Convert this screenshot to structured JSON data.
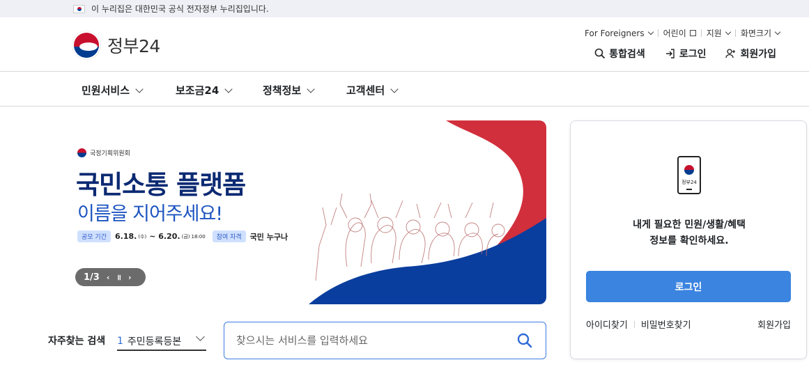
{
  "notice": {
    "text": "이 누리집은 대한민국 공식 전자정부 누리집입니다."
  },
  "logo": {
    "text": "정부24"
  },
  "util": {
    "foreigners": "For Foreigners",
    "kids": "어린이",
    "support": "지원",
    "zoom": "화면크기"
  },
  "actions": {
    "search": "통합검색",
    "login": "로그인",
    "signup": "회원가입"
  },
  "gnb": {
    "items": [
      {
        "label": "민원서비스"
      },
      {
        "label": "보조금24"
      },
      {
        "label": "정책정보"
      },
      {
        "label": "고객센터"
      }
    ]
  },
  "banner": {
    "org": "국정기획위원회",
    "headline": "국민소통 플랫폼",
    "sub": "이름을 지어주세요!",
    "period_tag": "공모 기간",
    "period_start": "6.18.",
    "start_day": "(수)",
    "period_end": "~ 6.20.",
    "end_day": "(금)",
    "end_time": "18:00",
    "target_tag": "참여 자격",
    "target": "국민 누구나",
    "counter": "1/3",
    "prev": "‹",
    "pause": "॥",
    "next": "›"
  },
  "search": {
    "freq_label": "자주찾는 검색",
    "freq_num": "1",
    "freq_value": "주민등록등본",
    "placeholder": "찾으시는 서비스를 입력하세요"
  },
  "login_panel": {
    "phone_label": "정부24",
    "msg_line1": "내게 필요한 민원/생활/혜택",
    "msg_line2": "정보를 확인하세요.",
    "login_button": "로그인",
    "find_id": "아이디찾기",
    "find_pw": "비밀번호찾기",
    "signup": "회원가입"
  },
  "colors": {
    "primary": "#3b84e0",
    "navy": "#0c2a73",
    "red": "#c8102e",
    "blue": "#003c8f"
  }
}
